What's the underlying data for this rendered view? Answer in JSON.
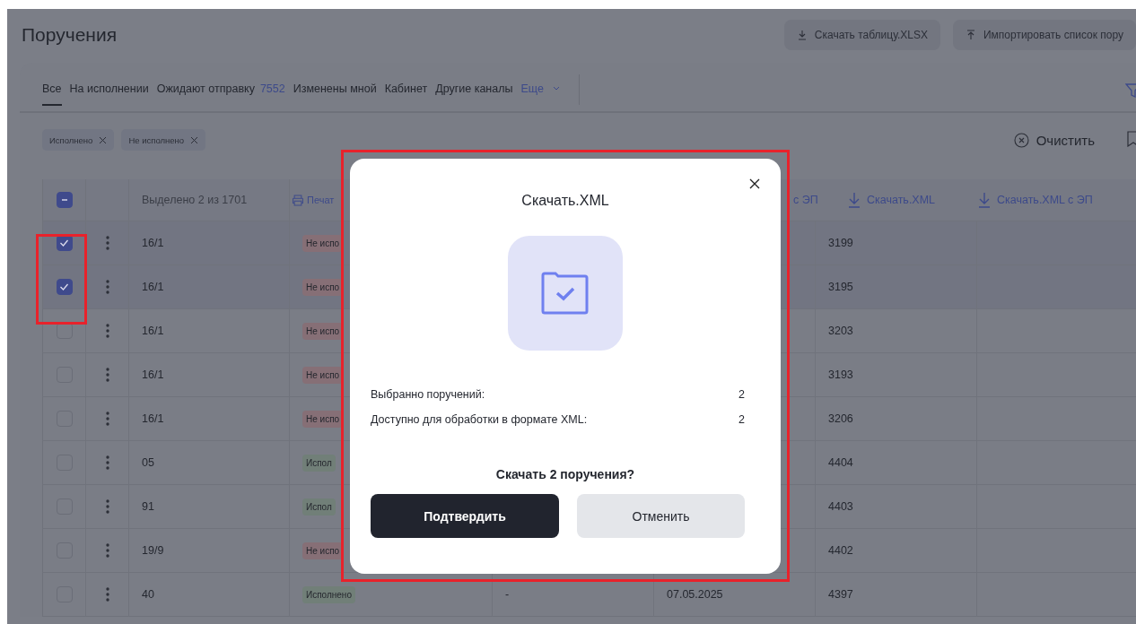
{
  "page": {
    "title": "Поручения",
    "actions": [
      {
        "kind": "download",
        "label": "Скачать таблицу.XLSX"
      },
      {
        "kind": "upload",
        "label": "Импортировать список пору"
      }
    ]
  },
  "tabs": [
    {
      "kind": "tab",
      "label": "Все",
      "selected": true
    },
    {
      "kind": "tab",
      "label": "На исполнении",
      "selected": false
    },
    {
      "kind": "tab",
      "label": "Ожидают отправку",
      "count": "7552",
      "selected": false
    },
    {
      "kind": "tab",
      "label": "Изменены мной",
      "selected": false
    },
    {
      "kind": "tab",
      "label": "Кабинет",
      "selected": false
    },
    {
      "kind": "tab",
      "label": "Другие каналы",
      "selected": false
    },
    {
      "kind": "more",
      "label": "Еще",
      "selected": false
    }
  ],
  "filters": [
    {
      "label": "Исполнено"
    },
    {
      "label": "Не исполнено"
    }
  ],
  "clear_label": "Очистить",
  "table": {
    "header_checked": true,
    "header_partial": true,
    "selection_label": "Выделено 2 из 1701",
    "bulk_actions": [
      {
        "kind": "print",
        "label": "Печат"
      },
      {
        "kind": "plain",
        "label": "с ЭП"
      },
      {
        "kind": "download",
        "label": "Скачать.XML"
      },
      {
        "kind": "download",
        "label": "Скачать.XML с ЭП"
      }
    ],
    "rows": [
      {
        "checked": true,
        "number": "16/1",
        "status": "Не испо",
        "color": "#866f76",
        "id": "3199"
      },
      {
        "checked": true,
        "number": "16/1",
        "status": "Не испо",
        "color": "#866f76",
        "id": "3195"
      },
      {
        "checked": false,
        "number": "16/1",
        "status": "Не испо",
        "color": "#866f76",
        "id": "3203"
      },
      {
        "checked": false,
        "number": "16/1",
        "status": "Не испо",
        "color": "#866f76",
        "id": "3193"
      },
      {
        "checked": false,
        "number": "16/1",
        "status": "Не испо",
        "color": "#866f76",
        "id": "3206"
      },
      {
        "checked": false,
        "number": "05",
        "status": "Испол",
        "color": "#717f78",
        "id": "4404"
      },
      {
        "checked": false,
        "number": "91",
        "status": "Испол",
        "color": "#717f78",
        "id": "4403"
      },
      {
        "checked": false,
        "number": "19/9",
        "status": "Не испо",
        "color": "#866f76",
        "id": "4402"
      },
      {
        "checked": false,
        "number": "40",
        "status": "Исполнено",
        "color": "#717f78",
        "column_4": "-",
        "date": "07.05.2025",
        "id": "4397"
      }
    ]
  },
  "modal": {
    "title": "Скачать.XML",
    "summary": [
      {
        "label": "Выбранно поручений:",
        "value": "2"
      },
      {
        "label": "Доступно для обработки в формате XML:",
        "value": "2"
      }
    ],
    "question": "Скачать 2 поручения?",
    "buttons": [
      {
        "kind": "primary",
        "label": "Подтвердить"
      },
      {
        "kind": "secondary",
        "label": "Отменить"
      }
    ]
  }
}
